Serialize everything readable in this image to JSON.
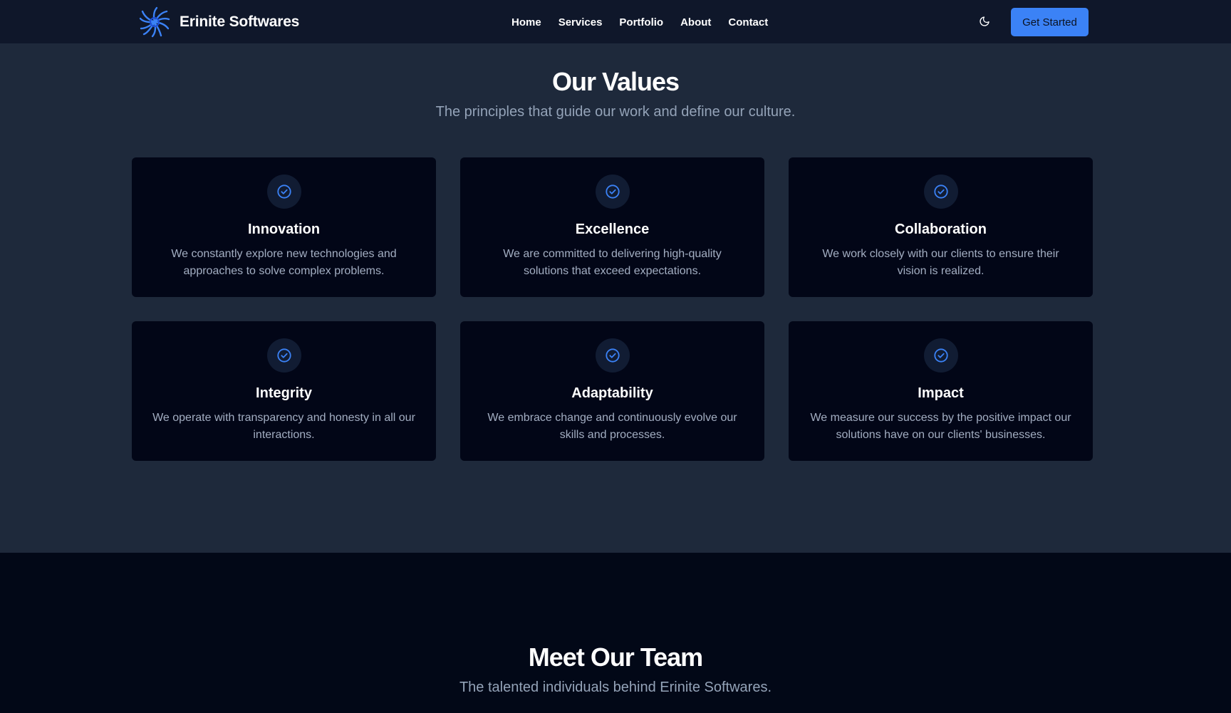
{
  "navbar": {
    "brand_name": "Erinite Softwares",
    "links": [
      "Home",
      "Services",
      "Portfolio",
      "About",
      "Contact"
    ],
    "cta_label": "Get Started"
  },
  "values": {
    "title": "Our Values",
    "subtitle": "The principles that guide our work and define our culture.",
    "cards": [
      {
        "title": "Innovation",
        "description": "We constantly explore new technologies and approaches to solve complex problems."
      },
      {
        "title": "Excellence",
        "description": "We are committed to delivering high-quality solutions that exceed expectations."
      },
      {
        "title": "Collaboration",
        "description": "We work closely with our clients to ensure their vision is realized."
      },
      {
        "title": "Integrity",
        "description": "We operate with transparency and honesty in all our interactions."
      },
      {
        "title": "Adaptability",
        "description": "We embrace change and continuously evolve our skills and processes."
      },
      {
        "title": "Impact",
        "description": "We measure our success by the positive impact our solutions have on our clients' businesses."
      }
    ]
  },
  "team": {
    "title": "Meet Our Team",
    "subtitle": "The talented individuals behind Erinite Softwares."
  },
  "icons": {
    "logo": "spiral-logo-icon",
    "theme": "moon-icon",
    "card": "check-circle-icon"
  },
  "colors": {
    "accent": "#3b82f6",
    "page_bg": "#1e293b",
    "nav_bg": "#0f172a",
    "card_bg": "#020617",
    "muted_text": "#94a3b8"
  }
}
